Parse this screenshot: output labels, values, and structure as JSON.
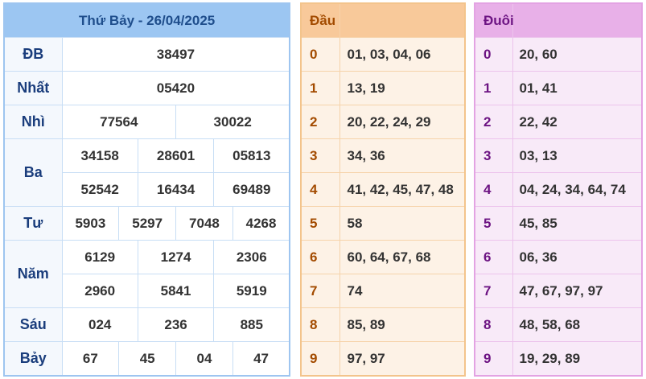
{
  "title": "Thứ Bảy - 26/04/2025",
  "prizes": {
    "db": {
      "label": "ĐB",
      "values": [
        "38497"
      ]
    },
    "nhat": {
      "label": "Nhất",
      "values": [
        "05420"
      ]
    },
    "nhi": {
      "label": "Nhì",
      "values": [
        "77564",
        "30022"
      ]
    },
    "ba": {
      "label": "Ba",
      "values": [
        "34158",
        "28601",
        "05813",
        "52542",
        "16434",
        "69489"
      ]
    },
    "tu": {
      "label": "Tư",
      "values": [
        "5903",
        "5297",
        "7048",
        "4268"
      ]
    },
    "nam": {
      "label": "Năm",
      "values": [
        "6129",
        "1274",
        "2306",
        "2960",
        "5841",
        "5919"
      ]
    },
    "sau": {
      "label": "Sáu",
      "values": [
        "024",
        "236",
        "885"
      ]
    },
    "bay": {
      "label": "Bảy",
      "values": [
        "67",
        "45",
        "04",
        "47"
      ]
    }
  },
  "dau": {
    "header": "Đầu",
    "rows": [
      {
        "k": "0",
        "v": "01, 03, 04, 06"
      },
      {
        "k": "1",
        "v": "13, 19"
      },
      {
        "k": "2",
        "v": "20, 22, 24, 29"
      },
      {
        "k": "3",
        "v": "34, 36"
      },
      {
        "k": "4",
        "v": "41, 42, 45, 47, 48"
      },
      {
        "k": "5",
        "v": "58"
      },
      {
        "k": "6",
        "v": "60, 64, 67, 68"
      },
      {
        "k": "7",
        "v": "74"
      },
      {
        "k": "8",
        "v": "85, 89"
      },
      {
        "k": "9",
        "v": "97, 97"
      }
    ]
  },
  "duoi": {
    "header": "Đuôi",
    "rows": [
      {
        "k": "0",
        "v": "20, 60"
      },
      {
        "k": "1",
        "v": "01, 41"
      },
      {
        "k": "2",
        "v": "22, 42"
      },
      {
        "k": "3",
        "v": "03, 13"
      },
      {
        "k": "4",
        "v": "04, 24, 34, 64, 74"
      },
      {
        "k": "5",
        "v": "45, 85"
      },
      {
        "k": "6",
        "v": "06, 36"
      },
      {
        "k": "7",
        "v": "47, 67, 97, 97"
      },
      {
        "k": "8",
        "v": "48, 58, 68"
      },
      {
        "k": "9",
        "v": "19, 29, 89"
      }
    ]
  },
  "colors": {
    "special": "#e01b24",
    "results_header": "#9cc6f2",
    "dau_header": "#f8c99a",
    "duoi_header": "#e8b0e8"
  }
}
